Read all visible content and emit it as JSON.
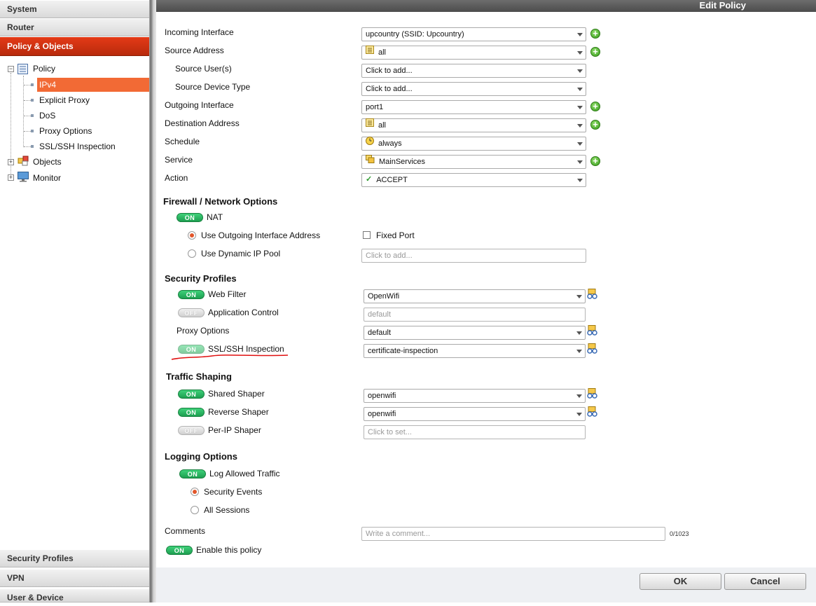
{
  "sidebar": {
    "top_headers": [
      "System",
      "Router",
      "Policy & Objects"
    ],
    "bottom_headers": [
      "Security Profiles",
      "VPN",
      "User & Device"
    ],
    "tree": {
      "policy": "Policy",
      "policy_children": [
        "IPv4",
        "Explicit Proxy",
        "DoS",
        "Proxy Options",
        "SSL/SSH Inspection"
      ],
      "objects": "Objects",
      "monitor": "Monitor"
    }
  },
  "page": {
    "title": "Edit Policy"
  },
  "form": {
    "incoming_interface": {
      "label": "Incoming Interface",
      "value": "upcountry (SSID: Upcountry)"
    },
    "source_address": {
      "label": "Source Address",
      "value": "all"
    },
    "source_users": {
      "label": "Source User(s)",
      "value": "Click to add..."
    },
    "source_device_type": {
      "label": "Source Device Type",
      "value": "Click to add..."
    },
    "outgoing_interface": {
      "label": "Outgoing Interface",
      "value": "port1"
    },
    "destination_address": {
      "label": "Destination Address",
      "value": "all"
    },
    "schedule": {
      "label": "Schedule",
      "value": "always"
    },
    "service": {
      "label": "Service",
      "value": "MainServices"
    },
    "action": {
      "label": "Action",
      "value": "ACCEPT"
    }
  },
  "firewall": {
    "title": "Firewall / Network Options",
    "nat": {
      "label": "NAT",
      "state": "ON"
    },
    "use_outgoing": "Use Outgoing Interface Address",
    "fixed_port": "Fixed Port",
    "use_dynamic_pool": "Use Dynamic IP Pool",
    "dynamic_pool_placeholder": "Click to add..."
  },
  "security_profiles": {
    "title": "Security Profiles",
    "web_filter": {
      "label": "Web Filter",
      "state": "ON",
      "value": "OpenWifi"
    },
    "app_control": {
      "label": "Application Control",
      "state": "OFF",
      "value": "default"
    },
    "proxy_options": {
      "label": "Proxy Options",
      "value": "default"
    },
    "ssl_ssh": {
      "label": "SSL/SSH Inspection",
      "state": "ON",
      "value": "certificate-inspection"
    }
  },
  "traffic_shaping": {
    "title": "Traffic Shaping",
    "shared": {
      "label": "Shared Shaper",
      "state": "ON",
      "value": "openwifi"
    },
    "reverse": {
      "label": "Reverse Shaper",
      "state": "ON",
      "value": "openwifi"
    },
    "per_ip": {
      "label": "Per-IP Shaper",
      "state": "OFF",
      "value": "Click to set..."
    }
  },
  "logging": {
    "title": "Logging Options",
    "log_allowed": {
      "label": "Log Allowed Traffic",
      "state": "ON"
    },
    "security_events": "Security Events",
    "all_sessions": "All Sessions"
  },
  "comments": {
    "label": "Comments",
    "placeholder": "Write a comment...",
    "count": "0/1023"
  },
  "enable_policy": {
    "label": "Enable this policy",
    "state": "ON"
  },
  "buttons": {
    "ok": "OK",
    "cancel": "Cancel"
  },
  "colors": {
    "accent": "#d9381a",
    "toggle_on": "#1fa455",
    "selected_row": "#f26a35"
  }
}
